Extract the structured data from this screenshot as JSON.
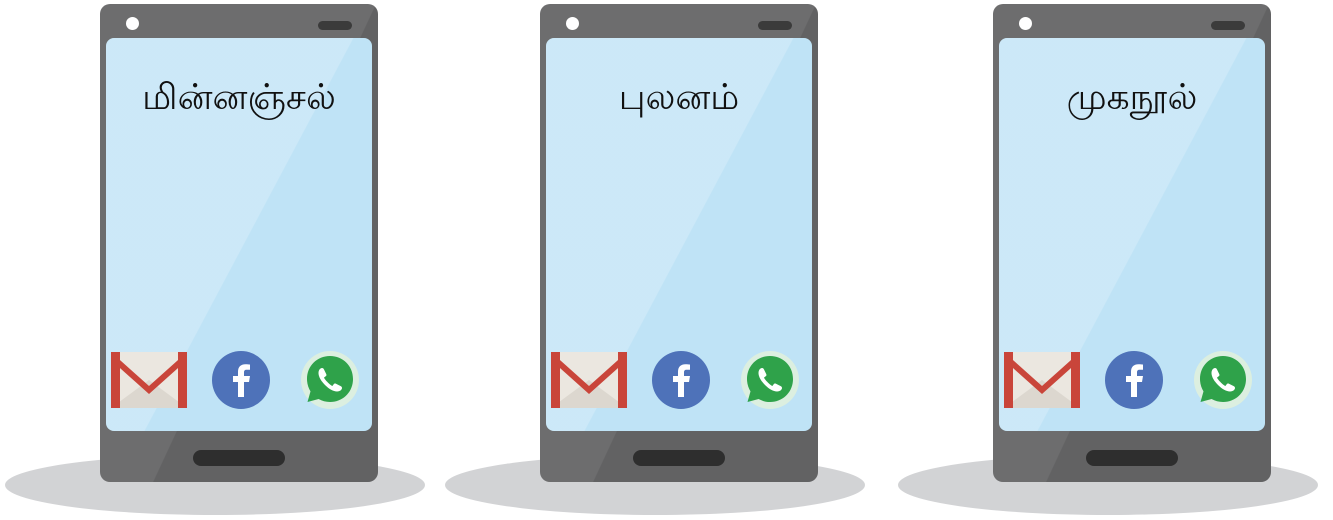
{
  "colors": {
    "phone_body": "#6d6d6e",
    "phone_body_dark": "#5a5a5c",
    "screen": "#bfe3f6",
    "shadow": "#d2d3d5",
    "facebook": "#4e72b9",
    "whatsapp": "#2fa24a",
    "gmail_red": "#c9453a",
    "gmail_envelope": "#ebe7e0"
  },
  "phones": [
    {
      "title": "மின்னஞ்சல்",
      "apps": [
        "gmail-icon",
        "facebook-icon",
        "whatsapp-icon"
      ]
    },
    {
      "title": "புலனம்",
      "apps": [
        "gmail-icon",
        "facebook-icon",
        "whatsapp-icon"
      ]
    },
    {
      "title": "முகநூல்",
      "apps": [
        "gmail-icon",
        "facebook-icon",
        "whatsapp-icon"
      ]
    }
  ]
}
